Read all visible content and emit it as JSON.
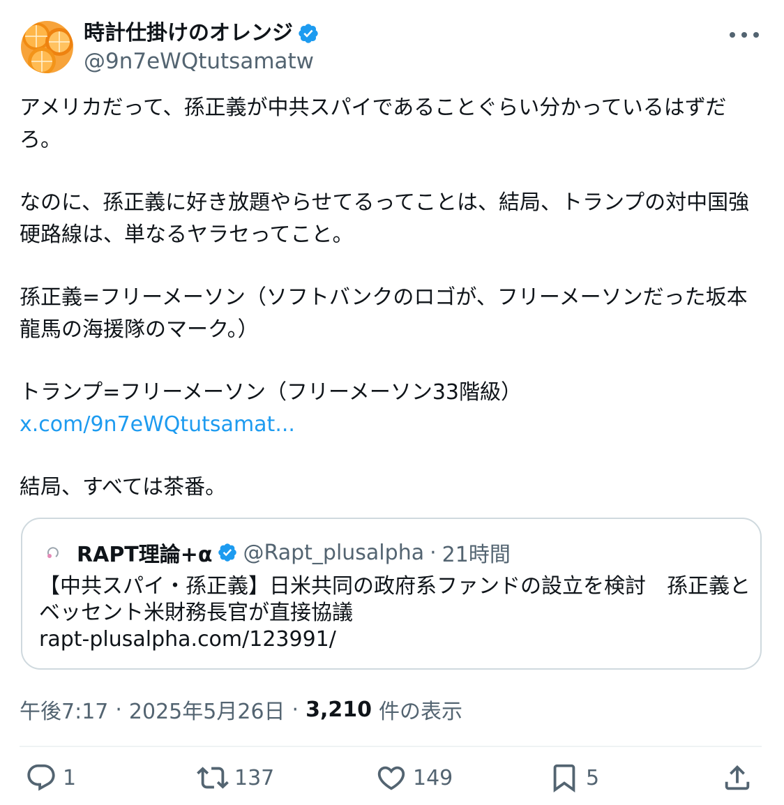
{
  "author": {
    "display_name": "時計仕掛けのオレンジ",
    "handle": "@9n7eWQtutsamatw",
    "verified": true,
    "avatar_icon": "orange-slices-avatar"
  },
  "post": {
    "paragraphs": [
      "アメリカだって、孫正義が中共スパイであることぐらい分かっているはずだろ。",
      "なのに、孫正義に好き放題やらせてるってことは、結局、トランプの対中国強硬路線は、単なるヤラセってこと。",
      "孫正義=フリーメーソン（ソフトバンクのロゴが、フリーメーソンだった坂本龍馬の海援隊のマーク。）",
      "トランプ=フリーメーソン（フリーメーソン33階級）",
      "結局、すべては茶番。"
    ],
    "link_text": "x.com/9n7eWQtutsamat..."
  },
  "quote": {
    "name": "RAPT理論+α",
    "handle": "@Rapt_plusalpha",
    "separator": "·",
    "time": "21時間",
    "text": "【中共スパイ・孫正義】日米共同の政府系ファンドの設立を検討　孫正義とベッセント米財務長官が直接協議",
    "link": "rapt-plusalpha.com/123991/"
  },
  "meta": {
    "time": "午後7:17",
    "separator": "·",
    "date": "2025年5月26日",
    "views": "3,210",
    "views_label": "件の表示"
  },
  "actions": {
    "replies": "1",
    "reposts": "137",
    "likes": "149",
    "bookmarks": "5"
  },
  "colors": {
    "text": "#0f1419",
    "secondary": "#536471",
    "link": "#1d9bf0",
    "verified": "#1d9bf0",
    "border": "#cfd9de"
  }
}
